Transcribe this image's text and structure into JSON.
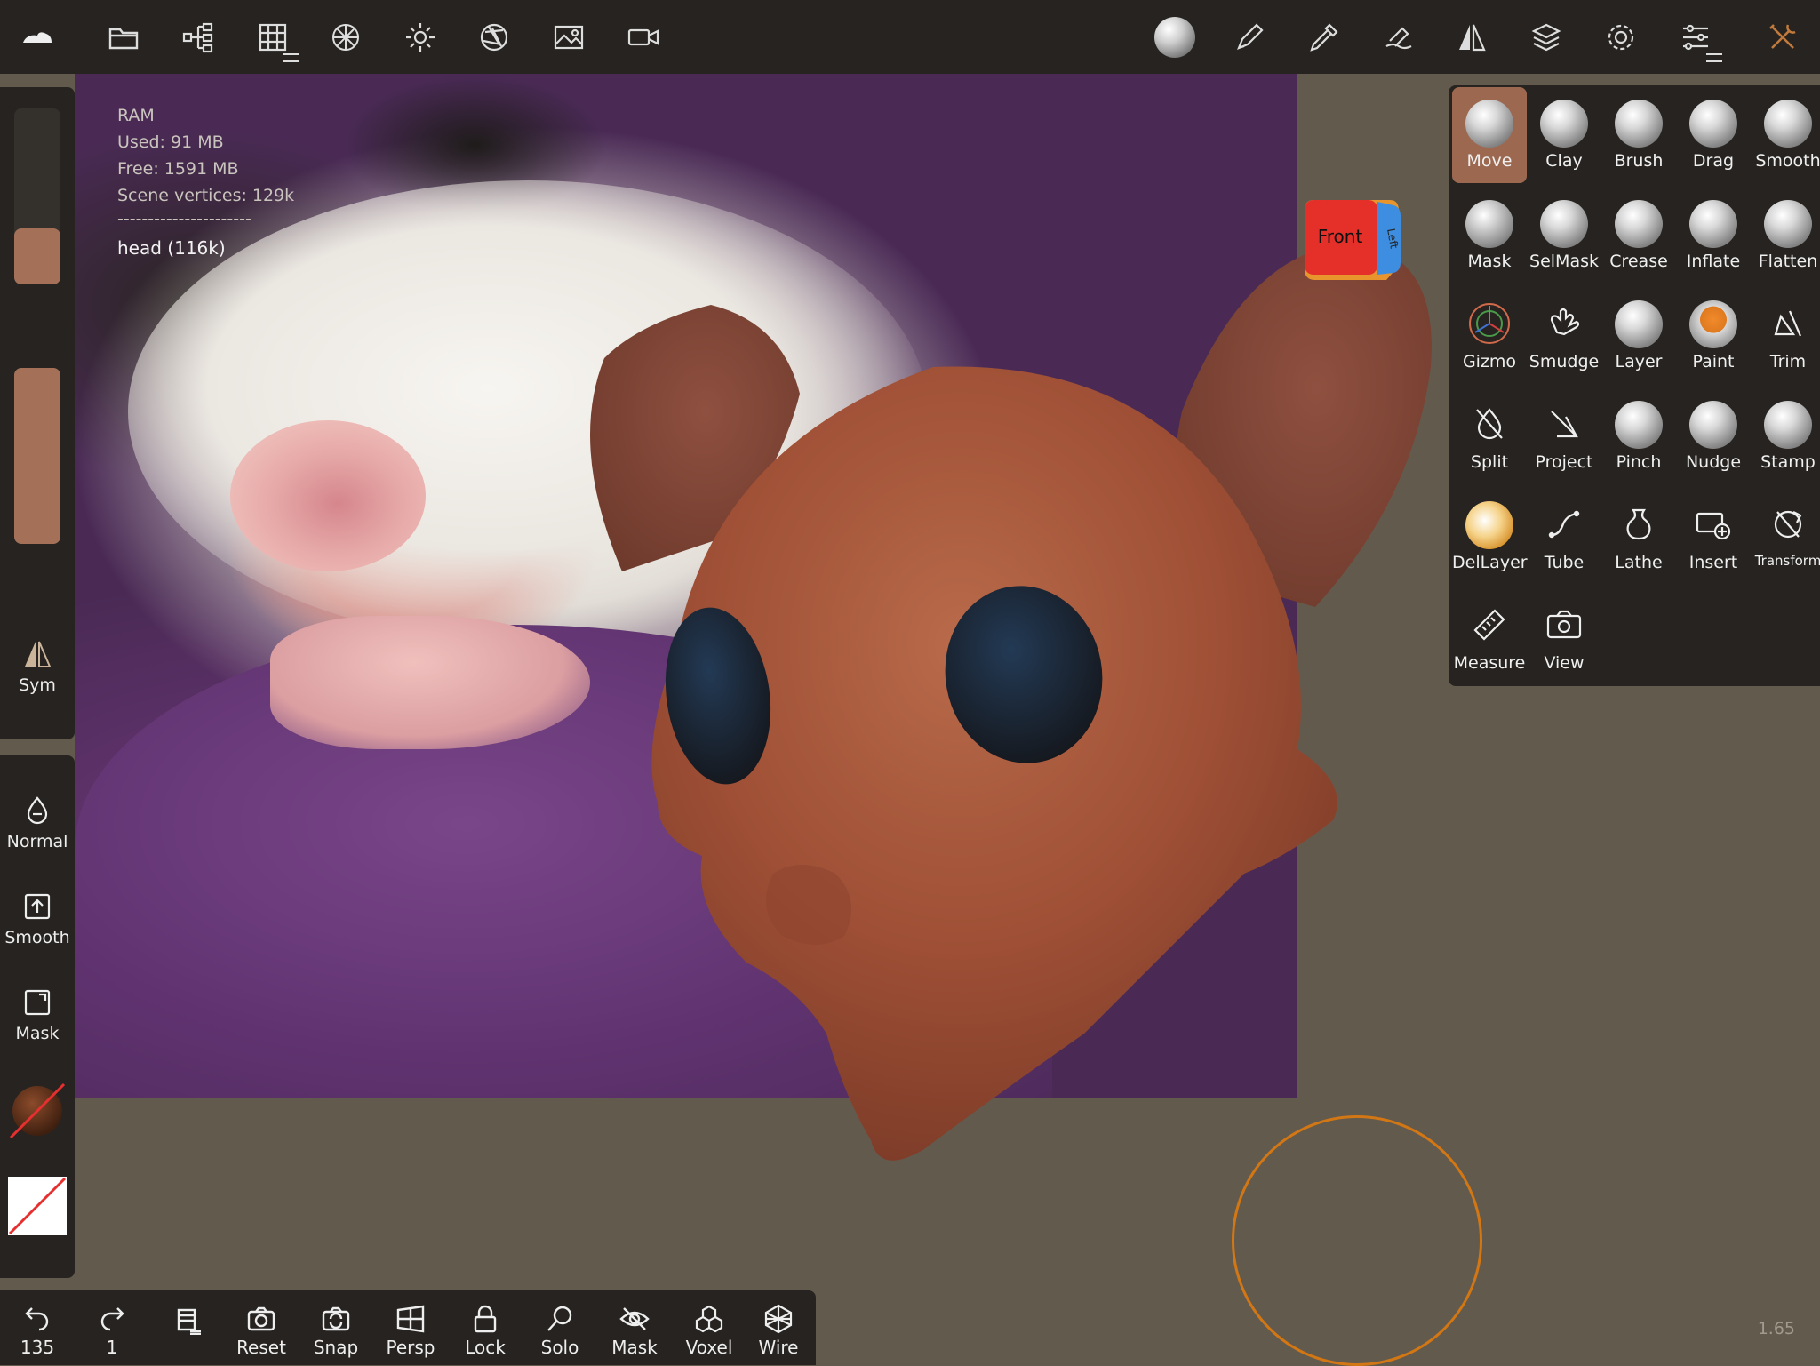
{
  "app": {
    "accent": "#9c6950",
    "panel_bg": "#262320",
    "canvas_bg": "#635a4e",
    "brush_color": "#a47158"
  },
  "top_toolbar": {
    "icons": [
      "cloud-icon",
      "folder-icon",
      "scene-tree-icon",
      "grid-icon",
      "material-sphere-icon",
      "light-icon",
      "aperture-icon",
      "image-icon",
      "video-icon",
      "matcap-sphere-icon",
      "pen-icon",
      "picker-icon",
      "paint-stroke-icon",
      "symmetry-icon",
      "layers-icon",
      "settings-icon",
      "sliders-icon",
      "tools-icon"
    ]
  },
  "info": {
    "ram_label": "RAM",
    "used": "Used: 91 MB",
    "free": "Free: 1591 MB",
    "vertices": "Scene vertices: 129k",
    "divider": "----------------------",
    "object": "head (116k)"
  },
  "left_panel": {
    "sym_label": "Sym",
    "normal_label": "Normal",
    "smooth_label": "Smooth",
    "mask_label": "Mask",
    "size_fraction": 0.32,
    "intensity_fraction": 1.0
  },
  "view_cube": {
    "front_label": "Front",
    "left_label": "Left"
  },
  "tools": {
    "items": [
      {
        "label": "Move",
        "icon": "move-icon",
        "active": true
      },
      {
        "label": "Clay",
        "icon": "clay-icon"
      },
      {
        "label": "Brush",
        "icon": "brush-icon"
      },
      {
        "label": "Drag",
        "icon": "drag-icon"
      },
      {
        "label": "Smooth",
        "icon": "smooth-icon"
      },
      {
        "label": "Mask",
        "icon": "mask-icon"
      },
      {
        "label": "SelMask",
        "icon": "selmask-icon"
      },
      {
        "label": "Crease",
        "icon": "crease-icon"
      },
      {
        "label": "Inflate",
        "icon": "inflate-icon"
      },
      {
        "label": "Flatten",
        "icon": "flatten-icon"
      },
      {
        "label": "Gizmo",
        "icon": "gizmo-icon"
      },
      {
        "label": "Smudge",
        "icon": "smudge-icon"
      },
      {
        "label": "Layer",
        "icon": "layer-icon"
      },
      {
        "label": "Paint",
        "icon": "paint-icon"
      },
      {
        "label": "Trim",
        "icon": "trim-icon"
      },
      {
        "label": "Split",
        "icon": "split-icon"
      },
      {
        "label": "Project",
        "icon": "project-icon"
      },
      {
        "label": "Pinch",
        "icon": "pinch-icon"
      },
      {
        "label": "Nudge",
        "icon": "nudge-icon"
      },
      {
        "label": "Stamp",
        "icon": "stamp-icon"
      },
      {
        "label": "DelLayer",
        "icon": "dellayer-icon"
      },
      {
        "label": "Tube",
        "icon": "tube-icon"
      },
      {
        "label": "Lathe",
        "icon": "lathe-icon"
      },
      {
        "label": "Insert",
        "icon": "insert-icon"
      },
      {
        "label": "Transform",
        "icon": "transform-icon"
      },
      {
        "label": "Measure",
        "icon": "measure-icon"
      },
      {
        "label": "View",
        "icon": "view-icon"
      }
    ]
  },
  "bottom_bar": {
    "undo_count": "135",
    "redo_count": "1",
    "reset": "Reset",
    "snap": "Snap",
    "persp": "Persp",
    "lock": "Lock",
    "solo": "Solo",
    "mask": "Mask",
    "voxel": "Voxel",
    "wire": "Wire"
  },
  "version": "1.65"
}
